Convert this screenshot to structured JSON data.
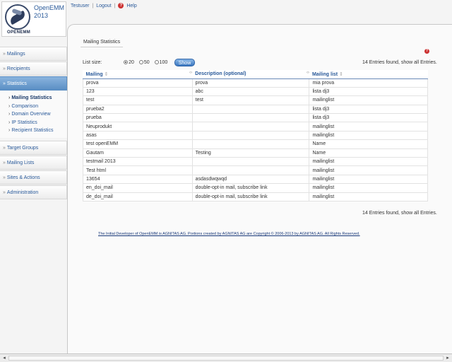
{
  "app": {
    "title_line1": "OpenEMM",
    "title_line2": "2013",
    "logo_text": "OPENEMM"
  },
  "top_links": {
    "user": "Testuser",
    "logout": "Logout",
    "help": "Help",
    "separator": "|"
  },
  "sidebar": {
    "items": [
      {
        "label": "Mailings"
      },
      {
        "label": "Recipients"
      },
      {
        "label": "Statistics"
      }
    ],
    "statistics_sub": [
      {
        "label": "Mailing Statistics"
      },
      {
        "label": "Comparison"
      },
      {
        "label": "Domain Overview"
      },
      {
        "label": "IP Statistics"
      },
      {
        "label": "Recipient Statistics"
      }
    ],
    "items2": [
      {
        "label": "Target Groups"
      },
      {
        "label": "Mailing Lists"
      },
      {
        "label": "Sites & Actions"
      },
      {
        "label": "Administration"
      }
    ]
  },
  "page": {
    "label": "Mailing Statistics",
    "list_size_label": "List size:",
    "list_size_options": [
      "20",
      "50",
      "100"
    ],
    "list_size_selected": "20",
    "show_button": "Show",
    "entries_top": "14 Entries found, show all Entries.",
    "entries_bottom": "14 Entries found, show all Entries."
  },
  "table": {
    "headers": [
      "Mailing",
      "Description (optional)",
      "Mailing list"
    ],
    "rows": [
      [
        "prova",
        "prova",
        "mia prova"
      ],
      [
        "123",
        "abc",
        "lista dj3"
      ],
      [
        "test",
        "test",
        "mailinglist"
      ],
      [
        "prueba2",
        "",
        "lista dj3"
      ],
      [
        "prueba",
        "",
        "lista dj3"
      ],
      [
        "Neuprodukt",
        "",
        "mailinglist"
      ],
      [
        "asas",
        "",
        "mailinglist"
      ],
      [
        "test openEMM",
        "",
        "Name"
      ],
      [
        "Gautam",
        "Testing",
        "Name"
      ],
      [
        "testmail 2013",
        "",
        "mailinglist"
      ],
      [
        "Test html",
        "",
        "mailinglist"
      ],
      [
        "13654",
        "asdasdwqwqd",
        "mailinglist"
      ],
      [
        "en_doi_mail",
        "double-opt-in mail, subscribe link",
        "mailinglist"
      ],
      [
        "de_doi_mail",
        "double-opt-in mail, subscribe link",
        "mailinglist"
      ]
    ]
  },
  "footer": "The Initial Developer of OpenEMM is AGNITAS AG. Portions created by AGNITAS AG are Copyright © 2006-2013 by AGNITAS AG. All Rights Reserved."
}
